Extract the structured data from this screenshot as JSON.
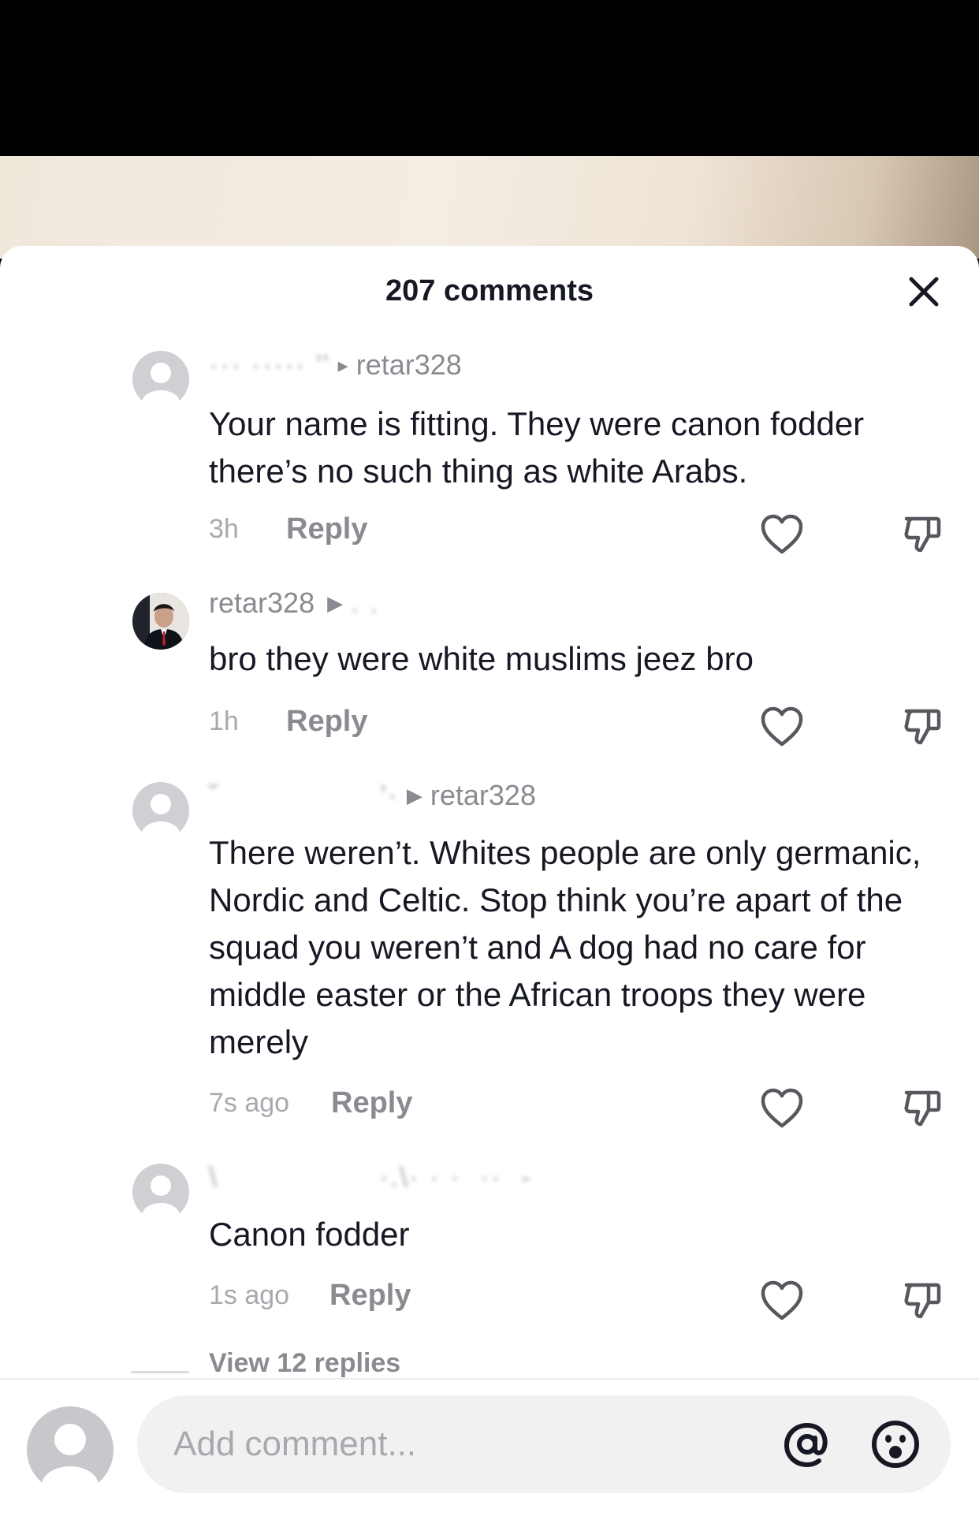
{
  "header": {
    "title": "207 comments"
  },
  "comments": [
    {
      "author": "",
      "reply_to": "retar328",
      "text": "Your name is fitting. They were canon fodder there’s no such thing as white Arabs.",
      "time": "3h",
      "reply_label": "Reply"
    },
    {
      "author": "retar328",
      "reply_to": "",
      "text": "bro they were white muslims jeez bro",
      "time": "1h",
      "reply_label": "Reply"
    },
    {
      "author": "",
      "reply_to": "retar328",
      "text": "There weren’t. Whites people are only germanic, Nordic and Celtic. Stop think you’re apart of the squad you weren’t and A dog had no care for middle easter or the African troops they were merely",
      "time": "7s ago",
      "reply_label": "Reply"
    },
    {
      "author": "",
      "reply_to": "",
      "text": "Canon fodder",
      "time": "1s ago",
      "reply_label": "Reply"
    }
  ],
  "view_replies": "View 12 replies",
  "composer": {
    "placeholder": "Add comment..."
  },
  "icons": {
    "close": "close-icon",
    "like": "heart-outline-icon",
    "dislike": "thumbs-down-icon",
    "mention": "at-sign-icon",
    "emoji": "emoji-icon"
  },
  "colors": {
    "text_primary": "#161823",
    "text_secondary": "#8a8b91",
    "background": "#ffffff"
  }
}
